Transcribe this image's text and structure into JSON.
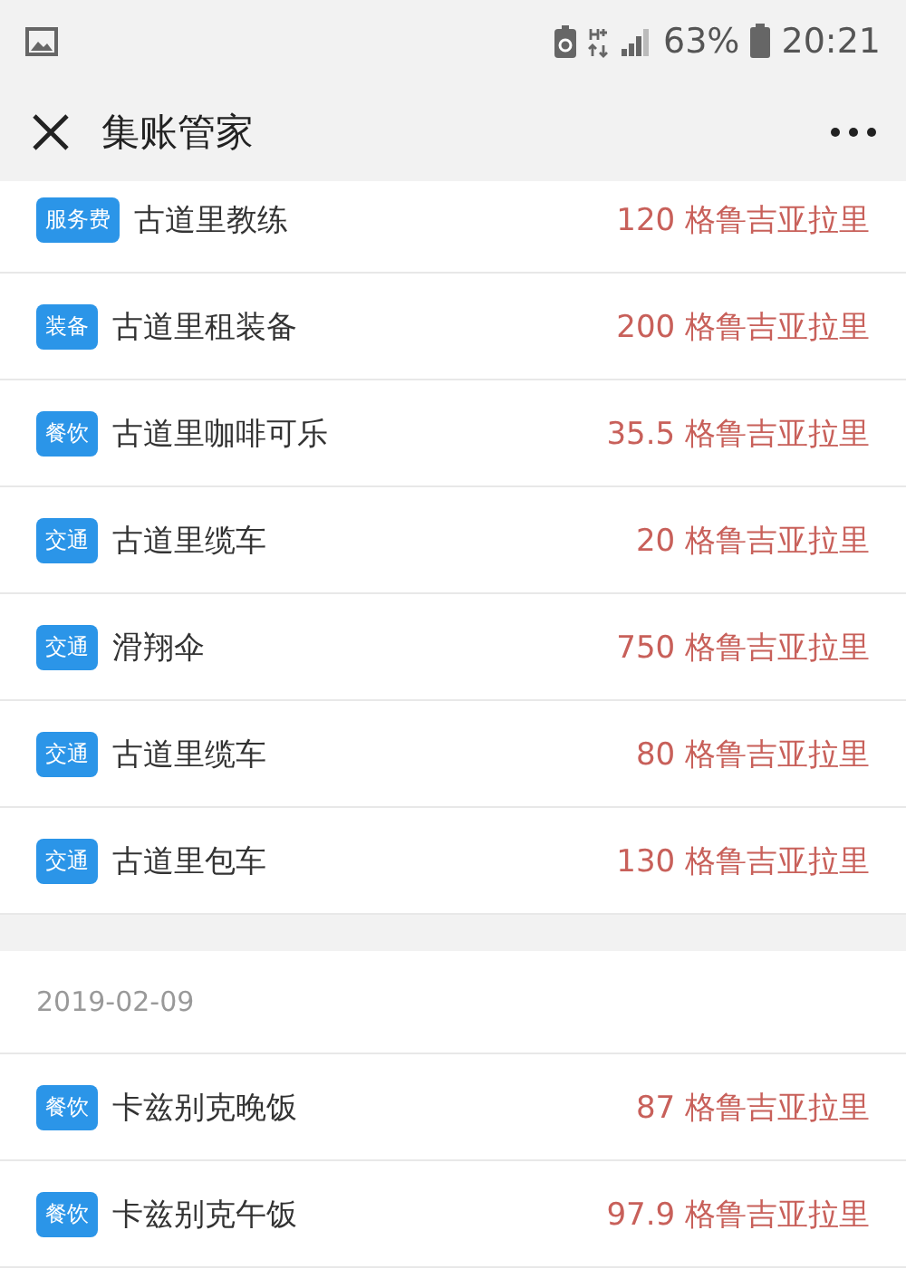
{
  "status_bar": {
    "battery": "63%",
    "time": "20:21"
  },
  "header": {
    "title": "集账管家"
  },
  "sections": [
    {
      "items": [
        {
          "category": "服务费",
          "name": "古道里教练",
          "amount": "120 格鲁吉亚拉里"
        },
        {
          "category": "装备",
          "name": "古道里租装备",
          "amount": "200 格鲁吉亚拉里"
        },
        {
          "category": "餐饮",
          "name": "古道里咖啡可乐",
          "amount": "35.5 格鲁吉亚拉里"
        },
        {
          "category": "交通",
          "name": "古道里缆车",
          "amount": "20 格鲁吉亚拉里"
        },
        {
          "category": "交通",
          "name": "滑翔伞",
          "amount": "750 格鲁吉亚拉里"
        },
        {
          "category": "交通",
          "name": "古道里缆车",
          "amount": "80 格鲁吉亚拉里"
        },
        {
          "category": "交通",
          "name": "古道里包车",
          "amount": "130 格鲁吉亚拉里"
        }
      ]
    },
    {
      "date": "2019-02-09",
      "items": [
        {
          "category": "餐饮",
          "name": "卡兹别克晚饭",
          "amount": "87 格鲁吉亚拉里"
        },
        {
          "category": "餐饮",
          "name": "卡兹别克午饭",
          "amount": "97.9 格鲁吉亚拉里"
        }
      ]
    }
  ]
}
